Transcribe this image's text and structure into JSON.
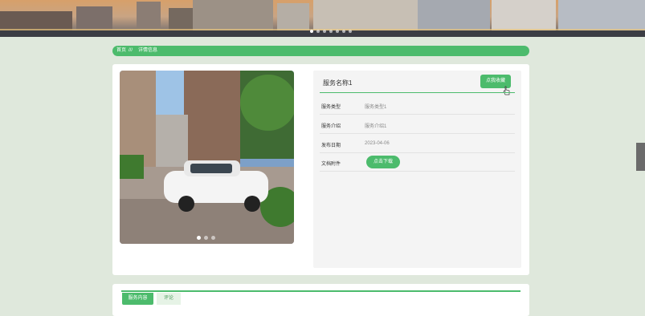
{
  "banner": {
    "slide_count": 7,
    "active_slide": 1
  },
  "breadcrumb": {
    "home": "首页",
    "separator": "///",
    "current": "详情信息"
  },
  "detail": {
    "title": "服务名称1",
    "collect_button": "点我收藏",
    "rows": [
      {
        "label": "服务类型",
        "value": "服务类型1"
      },
      {
        "label": "服务介绍",
        "value": "服务介绍1"
      },
      {
        "label": "发布日期",
        "value": "2023-04-06"
      },
      {
        "label": "文档附件",
        "value": ""
      }
    ],
    "download_button": "点击下载",
    "photo_dots": 3,
    "photo_active": 1
  },
  "tabs": [
    {
      "label": "服务内容"
    },
    {
      "label": "评论"
    }
  ],
  "colors": {
    "accent": "#4cbb6c",
    "page_bg": "#dfe8dc"
  }
}
